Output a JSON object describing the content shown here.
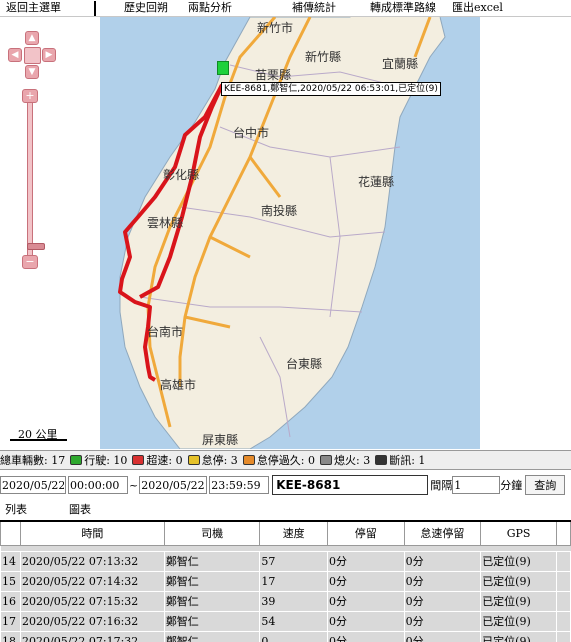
{
  "menu": {
    "items": [
      "返回主選單",
      "歷史回朔",
      "兩點分析",
      "補傳統計",
      "轉成標準路線",
      "匯出excel"
    ]
  },
  "map": {
    "scale_label": "20 公里",
    "vehicle_label": "KEE-8681,鄭智仁,2020/05/22 06:53:01,已定位(9)",
    "cities": [
      "新竹市",
      "新竹縣",
      "宜蘭縣",
      "苗栗縣",
      "台中市",
      "彰化縣",
      "花蓮縣",
      "南投縣",
      "雲林縣",
      "台南市",
      "台東縣",
      "高雄市",
      "屏東縣"
    ],
    "pan_icons": [
      "arrow-up-icon",
      "arrow-left-icon",
      "arrow-right-icon",
      "arrow-down-icon"
    ],
    "zoom_in": "+",
    "zoom_out": "−"
  },
  "stats": {
    "total_label": "總車輛數: 17",
    "driving_label": "行駛: 10",
    "speeding_label": "超速: 0",
    "stopped_label": "怠停: 3",
    "idle_long_label": "怠停過久: 0",
    "off_label": "熄火: 3",
    "offline_label": "斷訊: 1",
    "icon_colors": {
      "driving": "#2ea82e",
      "speeding": "#d83030",
      "stopped": "#e6c229",
      "idle_long": "#e58a2a",
      "off": "#888888",
      "offline": "#333333"
    }
  },
  "query": {
    "start_date": "2020/05/22",
    "start_time": "00:00:00",
    "separator": "~",
    "end_date": "2020/05/22",
    "end_time": "23:59:59",
    "plate": "KEE-8681",
    "interval_label": "間隔",
    "interval_value": "1",
    "interval_unit": "分鐘",
    "query_button": "查詢"
  },
  "tabs": [
    "列表",
    "圖表"
  ],
  "table": {
    "headers": [
      "",
      "時間",
      "司機",
      "速度",
      "停留",
      "怠速停留",
      "GPS"
    ],
    "rows": [
      [
        "14",
        "2020/05/22 07:13:32",
        "鄭智仁",
        "57",
        "0分",
        "0分",
        "已定位(9)"
      ],
      [
        "15",
        "2020/05/22 07:14:32",
        "鄭智仁",
        "17",
        "0分",
        "0分",
        "已定位(9)"
      ],
      [
        "16",
        "2020/05/22 07:15:32",
        "鄭智仁",
        "39",
        "0分",
        "0分",
        "已定位(9)"
      ],
      [
        "17",
        "2020/05/22 07:16:32",
        "鄭智仁",
        "54",
        "0分",
        "0分",
        "已定位(9)"
      ],
      [
        "18",
        "2020/05/22 07:17:32",
        "鄭智仁",
        "0",
        "0分",
        "0分",
        "已定位(9)"
      ]
    ]
  }
}
